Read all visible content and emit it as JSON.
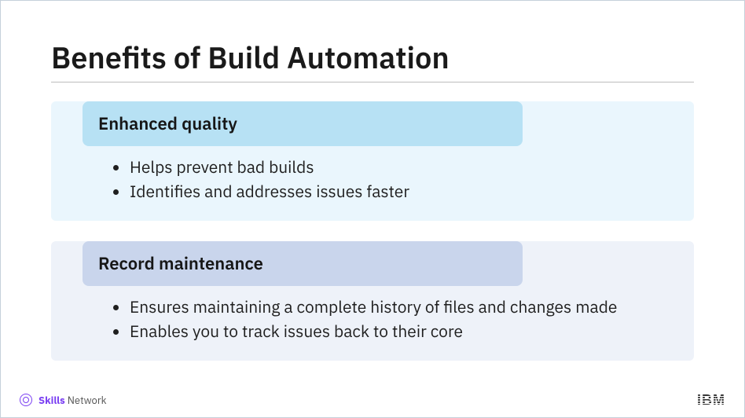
{
  "title": "Benefits of Build Automation",
  "sections": [
    {
      "heading": "Enhanced quality",
      "bullets": [
        "Helps prevent bad builds",
        "Identifies and addresses issues faster"
      ]
    },
    {
      "heading": "Record maintenance",
      "bullets": [
        "Ensures maintaining a complete history of files and changes made",
        "Enables you to track issues back to their core"
      ]
    }
  ],
  "footer": {
    "brand_strong": "Skills",
    "brand_light": " Network",
    "logo": "IBM"
  }
}
